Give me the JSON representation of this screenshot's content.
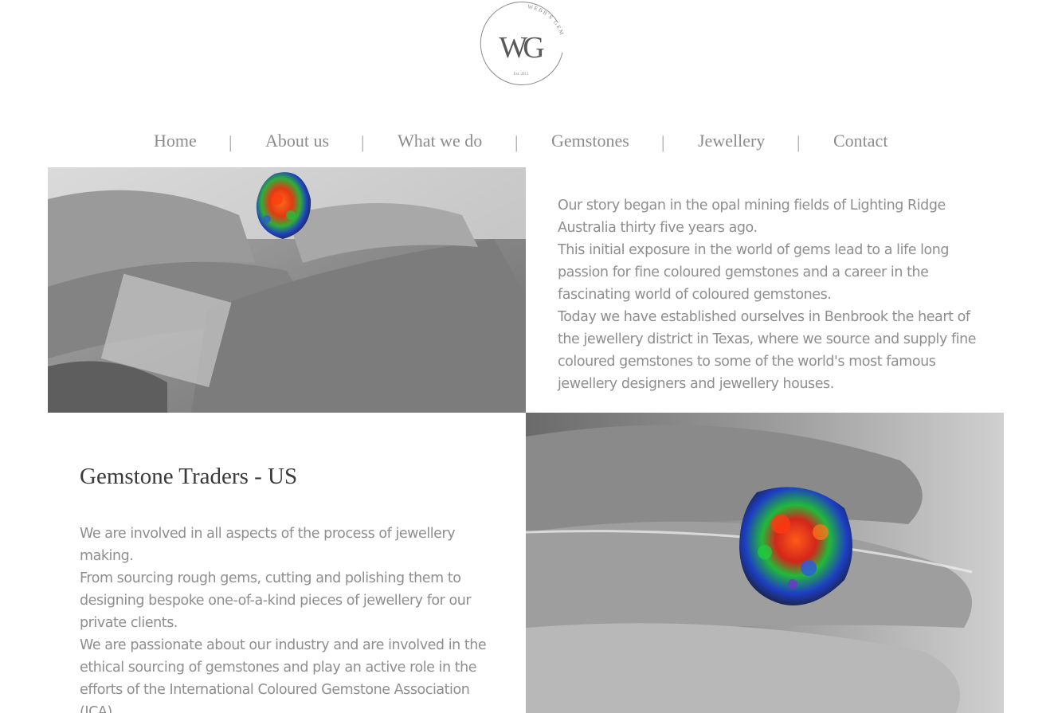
{
  "brand": {
    "monogram": "WG",
    "name_arc": "WEBB'S GEM",
    "est": "Est. 2011"
  },
  "nav": {
    "items": [
      {
        "label": "Home"
      },
      {
        "label": "About us"
      },
      {
        "label": "What we do"
      },
      {
        "label": "Gemstones"
      },
      {
        "label": "Jewellery"
      },
      {
        "label": "Contact"
      }
    ],
    "separator": "|"
  },
  "story": {
    "paragraphs": [
      "Our story began in the opal mining fields of Lighting Ridge Australia thirty five years ago.",
      "This initial exposure in the world of gems lead to a life long passion for fine coloured gemstones and a career in the fascinating world of coloured gemstones.",
      "Today we have established ourselves in Benbrook the heart of the jewellery district in Texas, where we source and supply fine coloured gemstones to some of the world's most famous jewellery designers and jewellery houses."
    ]
  },
  "traders": {
    "title": "Gemstone Traders - US",
    "paragraphs": [
      "We are involved in all aspects of the process of jewellery making.",
      "From sourcing rough gems, cutting and polishing them to designing bespoke one-of-a-kind pieces of jewellery for our private clients.",
      "We are passionate about our industry and are involved in the ethical sourcing of gemstones and play an active role in the efforts of the International Coloured Gemstone Association (ICA)."
    ]
  },
  "images": {
    "top": {
      "icon": "opal-in-hand-photo"
    },
    "bottom": {
      "icon": "opal-on-finger-photo"
    }
  },
  "colors": {
    "nav_text": "#8c8c8c",
    "body_text": "#8e8e8e",
    "title_text": "#3a3a3a",
    "background": "#ffffff"
  }
}
